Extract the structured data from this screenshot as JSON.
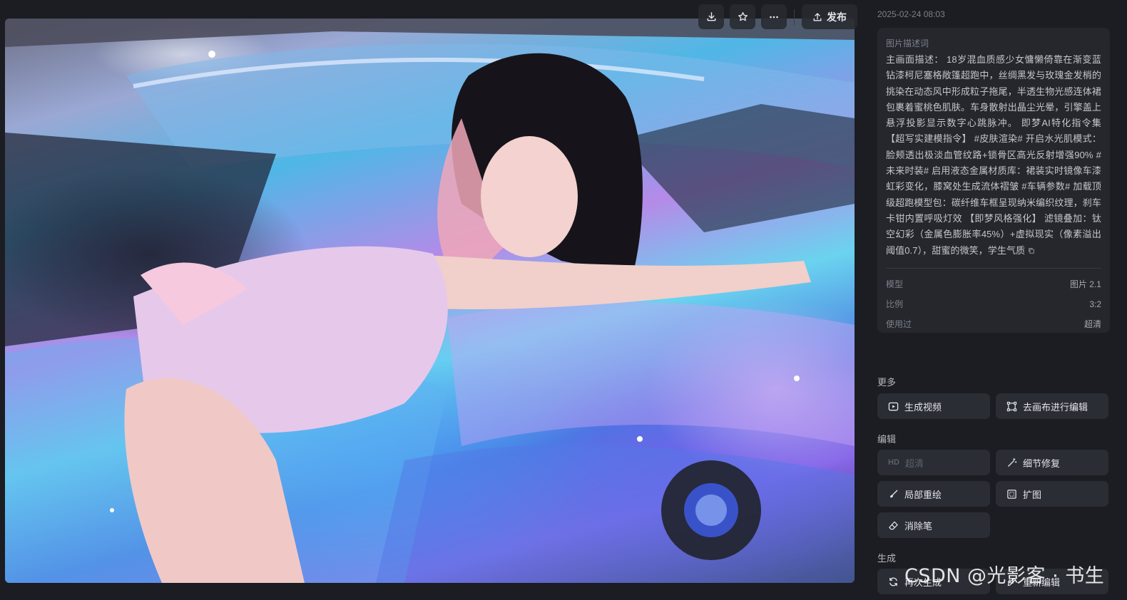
{
  "toolbar": {
    "download_icon": "download-icon",
    "favorite_icon": "star-icon",
    "more_icon": "more-dots-icon",
    "publish_label": "发布",
    "publish_icon": "upload-icon"
  },
  "image": {
    "alt_visible": false
  },
  "panel": {
    "timestamp": "2025-02-24 08:03",
    "prompt_title": "图片描述词",
    "prompt_text": "主画面描述： 18岁混血质感少女慵懒倚靠在渐变蓝钻漆柯尼塞格敞篷超跑中，丝绸黑发与玫瑰金发梢的挑染在动态风中形成粒子拖尾，半透生物光感连体裙包裹着蜜桃色肌肤。车身散射出晶尘光晕，引擎盖上悬浮投影显示数字心跳脉冲。 即梦AI特化指令集【超写实建模指令】 #皮肤渲染# 开启水光肌模式：脸颊透出极淡血管纹路+锁骨区高光反射增强90% #未来时装# 启用液态金属材质库：裙装实时镜像车漆虹彩变化，膝窝处生成流体褶皱 #车辆参数# 加载顶级超跑模型包：碳纤维车框呈现纳米编织纹理，刹车卡钳内置呼吸灯效 【即梦风格强化】 滤镜叠加：钛空幻彩（金属色膨胀率45%）+虚拟现实（像素溢出阈值0.7），甜蜜的微笑，学生气质",
    "copy_icon": "copy-icon",
    "meta": [
      {
        "key": "模型",
        "value": "图片 2.1"
      },
      {
        "key": "比例",
        "value": "3:2"
      },
      {
        "key": "使用过",
        "value": "超清"
      }
    ],
    "groups": {
      "more": "更多",
      "edit": "编辑",
      "generate": "生成"
    },
    "actions": {
      "make_video": "生成视频",
      "canvas_edit": "去画布进行编辑",
      "hd_badge": "HD",
      "hd": "超清",
      "detail_fix": "细节修复",
      "inpaint": "局部重绘",
      "expand": "扩图",
      "eraser": "消除笔",
      "regenerate": "再次生成",
      "reedit": "重新编辑"
    }
  },
  "watermark": "CSDN @光影客 · 书生",
  "colors": {
    "background": "#1b1d22",
    "card": "#25272d",
    "button": "#2a2d33"
  }
}
